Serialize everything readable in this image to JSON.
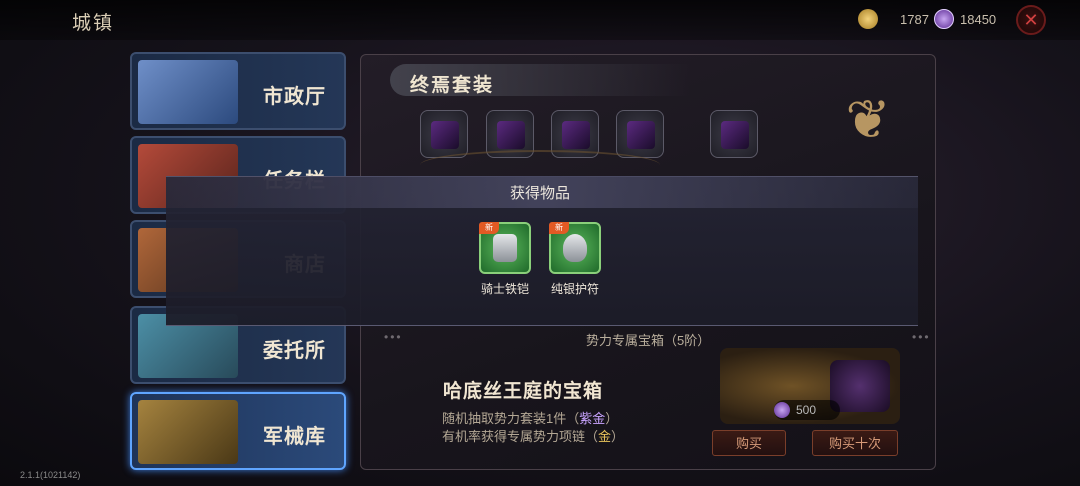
{
  "header": {
    "title": "城镇",
    "gold_amount": "1787",
    "gem_amount": "18450"
  },
  "sidebar": {
    "items": [
      {
        "label": "市政厅"
      },
      {
        "label": "任务栏"
      },
      {
        "label": "商店"
      },
      {
        "label": "委托所"
      },
      {
        "label": "军械库"
      }
    ]
  },
  "set": {
    "title": "终焉套装"
  },
  "chest": {
    "subtitle": "势力专属宝箱（5阶）",
    "name": "哈底丝王庭的宝箱",
    "desc1_prefix": "随机抽取势力套装1件（",
    "desc1_highlight": "紫金",
    "desc1_suffix": "）",
    "desc2_prefix": "有机率获得专属势力项链（",
    "desc2_highlight": "金",
    "desc2_suffix": "）",
    "price": "500",
    "buy_label": "购买",
    "buy_ten_label": "购买十次"
  },
  "popup": {
    "title": "获得物品",
    "items": [
      {
        "name": "骑士铁铠",
        "badge": "新"
      },
      {
        "name": "纯银护符",
        "badge": "新"
      }
    ]
  },
  "footer": {
    "version": "2.1.1(1021142)"
  }
}
